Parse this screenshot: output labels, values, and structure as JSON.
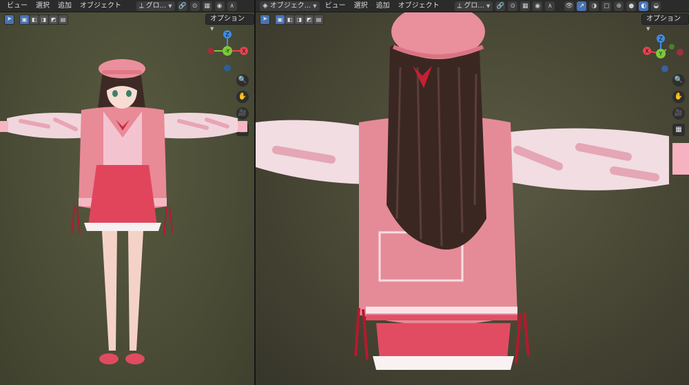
{
  "left_viewport": {
    "menu": [
      "ビュー",
      "選択",
      "追加",
      "オブジェクト"
    ],
    "transform_orientation": "グロ...",
    "options_label": "オプション",
    "gizmo": {
      "x_label": "X",
      "y_label": "-Y",
      "z_label": "Z"
    }
  },
  "right_viewport": {
    "mode_label": "オブジェク...",
    "menu": [
      "ビュー",
      "選択",
      "追加",
      "オブジェクト"
    ],
    "transform_orientation": "グロ...",
    "options_label": "オプション",
    "gizmo": {
      "x_label": "X",
      "y_label": "Y",
      "z_label": "Z"
    }
  },
  "colors": {
    "accent": "#4772b3",
    "axis_x": "#e8434f",
    "axis_y": "#7dc93c",
    "axis_z": "#3d8ce8",
    "header_bg": "#2b2b2b"
  },
  "icons": {
    "nav": [
      "zoom-icon",
      "hand-pan-icon",
      "camera-icon",
      "grid-perspective-icon"
    ]
  }
}
